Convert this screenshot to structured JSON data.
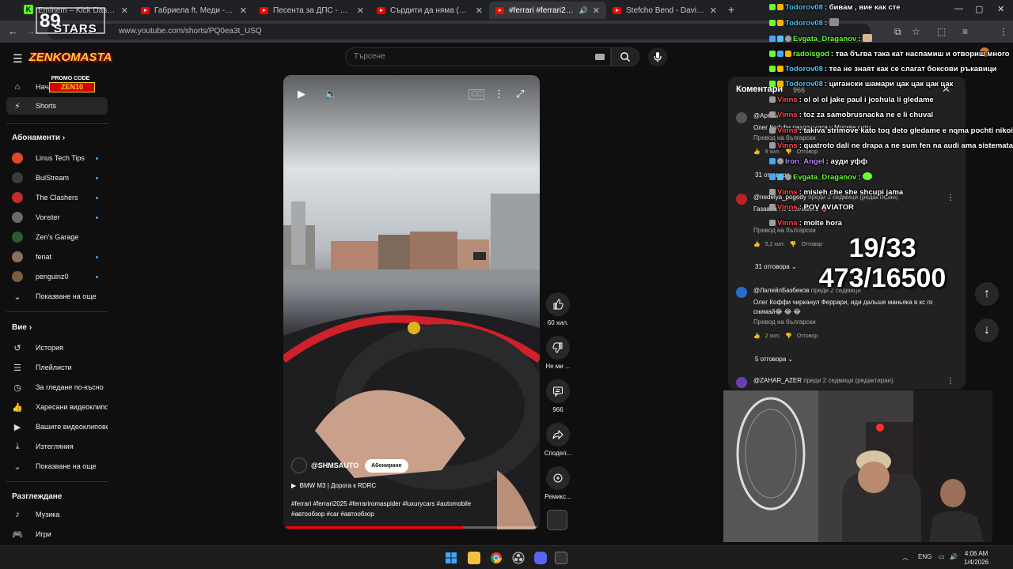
{
  "browser": {
    "tabs": [
      {
        "title": "Eminem – Kick Dash Stream",
        "active": false,
        "favicon": "kick"
      },
      {
        "title": "Габриела ft. Меди - Габриела",
        "active": false,
        "favicon": "youtube"
      },
      {
        "title": "Песента за ДПС - НОВО НАЧА",
        "active": false,
        "favicon": "youtube"
      },
      {
        "title": "Сърдити да няма (Official AI Au",
        "active": false,
        "favicon": "youtube"
      },
      {
        "title": "#ferrari #ferrari2025 #ferra",
        "active": true,
        "favicon": "youtube"
      },
      {
        "title": "Stefcho Bend - Davinchi Zakon",
        "active": false,
        "favicon": "youtube"
      }
    ],
    "url": "www.youtube.com/shorts/PQ0ea3t_USQ",
    "new_tab_icon": "plus-icon"
  },
  "overlay": {
    "stars_text": "STARS",
    "promo_title": "ZENKOMASTA",
    "promo_code_label": "PROMO CODE",
    "promo_code": "ZEN10"
  },
  "youtube": {
    "search_placeholder": "Търсене",
    "sidebar": {
      "top": [
        {
          "label": "Начало",
          "icon": "home-icon"
        },
        {
          "label": "Shorts",
          "icon": "shorts-icon",
          "active": true
        }
      ],
      "subscriptions_heading": "Абонаменти",
      "subscriptions": [
        {
          "label": "Linus Tech Tips",
          "color": "#e2462b"
        },
        {
          "label": "BulStream",
          "color": "#3b3b3b"
        },
        {
          "label": "The Clashers",
          "color": "#c42b2b"
        },
        {
          "label": "Vonster",
          "color": "#6b6b6b"
        },
        {
          "label": "Zen's Garage",
          "color": "#2f5a34"
        },
        {
          "label": "fenat",
          "color": "#8a6f5a"
        },
        {
          "label": "penguinz0",
          "color": "#7b5b3b"
        }
      ],
      "show_more": "Показване на още",
      "you_heading": "Вие",
      "you_items": [
        {
          "label": "История",
          "icon": "history-icon"
        },
        {
          "label": "Плейлисти",
          "icon": "playlist-icon"
        },
        {
          "label": "За гледане по-късно",
          "icon": "watch-later-icon"
        },
        {
          "label": "Харесани видеоклипове",
          "icon": "like-icon"
        },
        {
          "label": "Вашите видеоклипове",
          "icon": "your-videos-icon"
        },
        {
          "label": "Изтегляния",
          "icon": "download-icon"
        }
      ],
      "show_more_2": "Показване на още",
      "explore_heading": "Разглеждане",
      "explore_items": [
        {
          "label": "Музика",
          "icon": "music-icon"
        },
        {
          "label": "Игри",
          "icon": "gaming-icon"
        }
      ]
    },
    "short": {
      "channel": "@SHMSAUTO",
      "subscribe": "Абониране",
      "music": "BMW M3 | Дорога к RDRC",
      "description": "#ferrari #ferrari2025 #ferrariromaspider #luxurycars #automobile #автообзор #car #автообзор",
      "progress": 0.7
    },
    "actions": [
      {
        "label": "60 хил.",
        "icon": "thumbs-up-icon"
      },
      {
        "label": "Не ми ...",
        "icon": "thumbs-down-icon"
      },
      {
        "label": "966",
        "icon": "comment-icon"
      },
      {
        "label": "Сподел...",
        "icon": "share-icon"
      },
      {
        "label": "Ремикс...",
        "icon": "remix-icon"
      }
    ],
    "comments": {
      "title": "Коментари",
      "count": "966",
      "items": [
        {
          "author": "@Артем...",
          "when": "",
          "text": "Олег Коффи разложился у Москва сити",
          "translate": "Превод на български",
          "likes": "9 хил.",
          "reply": "Отговор",
          "replies": "31 отговора",
          "color": "#555"
        },
        {
          "author": "@nedelya_pogody",
          "when": "преди 2 седмици (редактиран)",
          "text": "Газаааа Пс 3.9к жесть ❤️",
          "translate": "Превод на български",
          "likes": "5,2 хил.",
          "reply": "Отговор",
          "replies": "31 отговора",
          "color": "#b22"
        },
        {
          "author": "@ЛалейлБазбеков",
          "when": "преди 2 седмици",
          "text": "Олег Коффи чирканул Феррари, иди дальше маньяка в кс го снимай😂 😂 😂",
          "translate": "Превод на български",
          "likes": "2 хил.",
          "reply": "Отговор",
          "replies": "5 отговора",
          "color": "#2a6ccc"
        },
        {
          "author": "@ZAHAR_AZER",
          "when": "преди 2 седмици (редактиран)",
          "text": "",
          "translate": "",
          "likes": "",
          "reply": "",
          "replies": "",
          "color": "#6a3fb0"
        }
      ]
    }
  },
  "chat": [
    {
      "name": "Todorov08",
      "msg": "бивам , вие как сте",
      "color": "#4fc3f7"
    },
    {
      "name": "Todorov08",
      "msg": "",
      "color": "#4fc3f7"
    },
    {
      "name": "Evgata_Draganov",
      "msg": "",
      "color": "#66ff33"
    },
    {
      "name": "radoisgod",
      "msg": "тва бъгва така кат наспамиш и отвориш много",
      "color": "#66ff33"
    },
    {
      "name": "Todorov08",
      "msg": "теа не знаят как се слагат боксови ръкавици",
      "color": "#4fc3f7"
    },
    {
      "name": "Todorov08",
      "msg": "цигански шамари цак цак цак цак",
      "color": "#4fc3f7"
    },
    {
      "name": "Vinns",
      "msg": "ol ol ol jake paul i joshula li gledame",
      "color": "#ff4d4d"
    },
    {
      "name": "Vinns",
      "msg": "toz za samobrusnacka ne e li chuval",
      "color": "#ff4d4d"
    },
    {
      "name": "Vinns",
      "msg": "takiva strimove kato toq deto gledame e nqma pochti nikoi",
      "color": "#ff4d4d"
    },
    {
      "name": "Vinns",
      "msg": "quatroto dali ne drapa a ne sum fen na audi ama sistemata",
      "color": "#ff4d4d"
    },
    {
      "name": "Iron_Angel",
      "msg": "ауди уфф",
      "color": "#b388ff"
    },
    {
      "name": "Evgata_Draganov",
      "msg": "",
      "color": "#66ff33"
    },
    {
      "name": "Vinns",
      "msg": "misleh che she shcupi jama",
      "color": "#ff4d4d"
    },
    {
      "name": "Vinns",
      "msg": "POV AVIATOR",
      "color": "#ff4d4d"
    },
    {
      "name": "Vinns",
      "msg": "moite hora",
      "color": "#ff4d4d"
    }
  ],
  "counter": {
    "line1": "19/33",
    "line2": "473/16500"
  },
  "taskbar": {
    "lang": "ENG",
    "time": "4:06 AM",
    "date": "1/4/2026"
  }
}
